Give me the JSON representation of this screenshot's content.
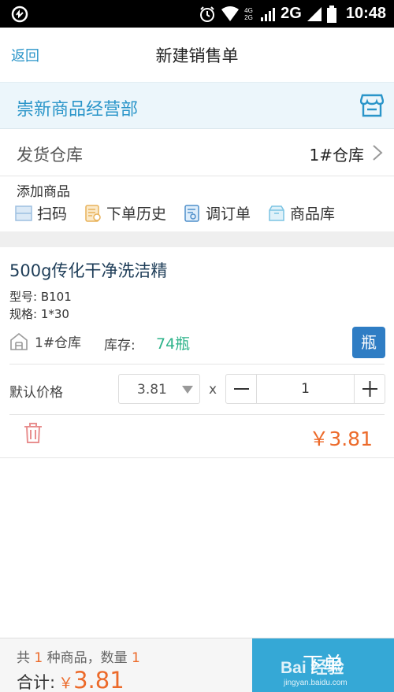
{
  "status_bar": {
    "network_label": "4G 2G",
    "network": "2G",
    "time": "10:48",
    "icons": [
      "app-notification-icon",
      "alarm-icon",
      "wifi-icon",
      "signal-icon",
      "signal-icon",
      "battery-icon"
    ]
  },
  "nav": {
    "back_label": "返回",
    "title": "新建销售单"
  },
  "store": {
    "name": "崇新商品经营部",
    "icon": "store-icon"
  },
  "warehouse": {
    "label": "发货仓库",
    "value": "1#仓库"
  },
  "add_products": {
    "heading": "添加商品",
    "actions": [
      {
        "label": "扫码",
        "icon": "scan-icon"
      },
      {
        "label": "下单历史",
        "icon": "history-icon"
      },
      {
        "label": "调订单",
        "icon": "order-icon"
      },
      {
        "label": "商品库",
        "icon": "product-library-icon"
      }
    ]
  },
  "product": {
    "name": "500g传化干净洗洁精",
    "model": "型号: B101",
    "spec": "规格: 1*30",
    "warehouse": "1#仓库",
    "stock_label": "库存:",
    "stock_value": "74瓶",
    "unit": "瓶",
    "price_label": "默认价格",
    "price_value": "3.81",
    "multiply": "x",
    "quantity": "1",
    "line_total": "￥3.81",
    "colors": {
      "stock": "#2db38a",
      "price": "#ec6a2a",
      "unit_button": "#2f7dc4"
    }
  },
  "footer": {
    "summary_prefix": "共",
    "kinds": "1",
    "summary_middle": "种商品，数量",
    "count": "1",
    "total_label": "合计:",
    "currency": "￥",
    "total_amount": "3.81",
    "submit_label": "下单",
    "submit_color": "#35a8d6"
  },
  "watermark": {
    "logo": "Bai 经验",
    "url": "jingyan.baidu.com"
  }
}
